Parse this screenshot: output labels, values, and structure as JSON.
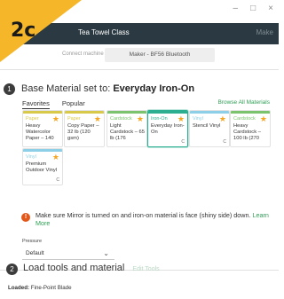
{
  "step_tag": "2c",
  "window": {
    "minimize": "–",
    "maximize": "□",
    "close": "×"
  },
  "header": {
    "title": "Tea Towel Class",
    "make": "Make"
  },
  "machine": {
    "label": "Connect machine",
    "value": "Maker - BF56 Bluetooth"
  },
  "step1": {
    "number": "1",
    "prefix": "Base Material set to:",
    "material": "Everyday Iron-On",
    "tabs": [
      "Favorites",
      "Popular"
    ],
    "active_tab": "Favorites",
    "browse_label": "Browse All Materials",
    "cards": [
      {
        "category": "Paper",
        "name": "Heavy Watercolor Paper – 140",
        "color": "#d9c94a",
        "selected": false,
        "mark": ""
      },
      {
        "category": "Paper",
        "name": "Copy Paper – 32 lb (120 gsm)",
        "color": "#d9c94a",
        "selected": false,
        "mark": ""
      },
      {
        "category": "Cardstock",
        "name": "Light Cardstock – 65 lb (176",
        "color": "#7cc36e",
        "selected": false,
        "mark": ""
      },
      {
        "category": "Iron-On",
        "name": "Everyday Iron-On",
        "color": "#2cae90",
        "selected": true,
        "mark": "C"
      },
      {
        "category": "Vinyl",
        "name": "Stencil Vinyl",
        "color": "#8ccfe6",
        "selected": false,
        "mark": "C"
      },
      {
        "category": "Cardstock",
        "name": "Heavy Cardstock – 100 lb (270",
        "color": "#7cc36e",
        "selected": false,
        "mark": ""
      },
      {
        "category": "Vinyl",
        "name": "Premium Outdoor Vinyl",
        "color": "#8ccfe6",
        "selected": false,
        "mark": "C"
      }
    ]
  },
  "warning": {
    "icon": "!",
    "text": "Make sure Mirror is turned on and iron-on material is face (shiny side) down.",
    "link": "Learn More"
  },
  "pressure": {
    "label": "Pressure",
    "value": "Default"
  },
  "step2": {
    "number": "2",
    "title": "Load tools and material",
    "edit_label": "Edit Tools",
    "loaded_label": "Loaded:",
    "loaded_value": "Fine-Point Blade"
  }
}
